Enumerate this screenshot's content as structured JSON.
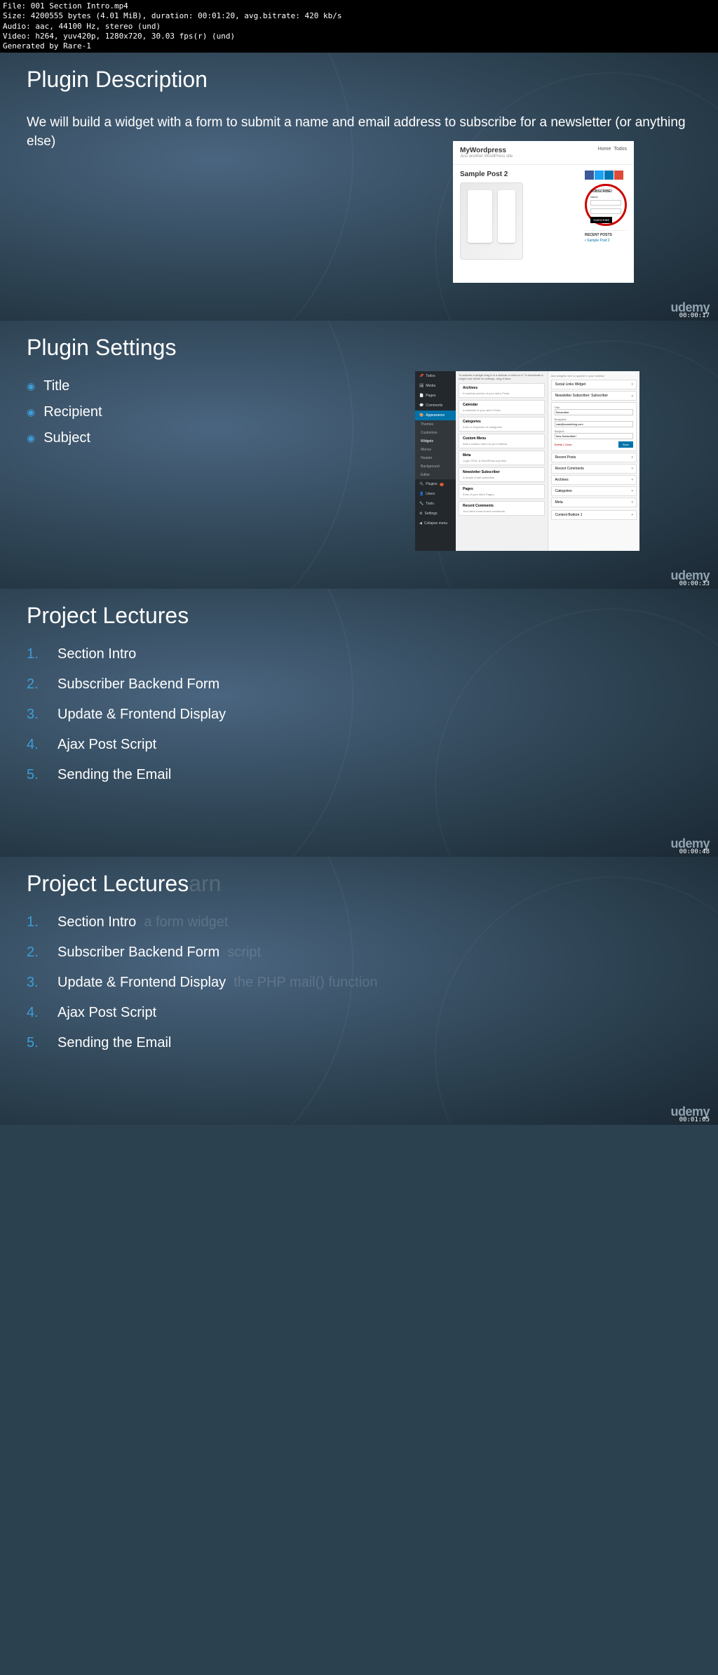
{
  "meta": {
    "file": "File: 001 Section Intro.mp4",
    "size": "Size: 4200555 bytes (4.01 MiB), duration: 00:01:20, avg.bitrate: 420 kb/s",
    "audio": "Audio: aac, 44100 Hz, stereo (und)",
    "video": "Video: h264, yuv420p, 1280x720, 30.03 fps(r) (und)",
    "gen": "Generated by Rare-1"
  },
  "slide1": {
    "title": "Plugin Description",
    "body": "We will build a widget with a form to submit a name and email address to subscribe for a newsletter (or anything else)",
    "thumb": {
      "sitename": "MyWordpress",
      "tagline": "Just another WordPress site",
      "nav1": "Home",
      "nav2": "Todos",
      "post_title": "Sample Post 2",
      "subscribe_label": "SUBSCRIBE!",
      "name_label": "Name",
      "subscribe_btn": "SUBSCRIBE",
      "recent_label": "RECENT POSTS",
      "recent_item": "Sample Post 2"
    },
    "timestamp": "00:00:17"
  },
  "slide2": {
    "title": "Plugin Settings",
    "bullets": [
      "Title",
      "Recipient",
      "Subject"
    ],
    "thumb": {
      "menu": [
        "Todos",
        "Media",
        "Pages",
        "Comments"
      ],
      "active_menu": "Appearance",
      "sub_menu": [
        "Themes",
        "Customize",
        "Widgets",
        "Menus",
        "Header",
        "Background",
        "Editor"
      ],
      "menu_bottom": [
        "Plugins",
        "Users",
        "Tools",
        "Settings",
        "Collapse menu"
      ],
      "hint": "To activate a widget drag it to a sidebar or click on it. To deactivate a widget and delete its settings, drag it back.",
      "widgets": [
        {
          "name": "Archives",
          "desc": "A monthly archive of your site's Posts."
        },
        {
          "name": "Calendar",
          "desc": "A calendar of your site's Posts."
        },
        {
          "name": "Categories",
          "desc": "A list or dropdown of categories."
        },
        {
          "name": "Custom Menu",
          "desc": "Add a custom menu to your sidebar."
        },
        {
          "name": "Meta",
          "desc": "Login, RSS, & WordPress.org links."
        },
        {
          "name": "Newsletter Subscriber",
          "desc": "A simple email subscriber"
        },
        {
          "name": "Pages",
          "desc": "A list of your site's Pages."
        },
        {
          "name": "Recent Comments",
          "desc": "Your site's most recent comments."
        }
      ],
      "zone_hint": "Add widgets here to appear in your sidebar.",
      "zone_widgets": [
        "Social Links Widget"
      ],
      "expanded_title": "Newsletter Subscriber: Subscriber",
      "form": {
        "title_label": "Title:",
        "title_value": "Subscriber",
        "recipient_label": "Recipient:",
        "recipient_value": "brad@something.com",
        "subject_label": "Subject:",
        "subject_value": "New Subscriber!",
        "delete": "Delete",
        "close": "Close",
        "save": "Save"
      },
      "collapsed": [
        "Recent Posts",
        "Recent Comments",
        "Archives",
        "Categories",
        "Meta"
      ],
      "bottom_zone": "Content Bottom 1"
    },
    "timestamp": "00:00:33"
  },
  "slide3": {
    "title": "Project Lectures",
    "items": [
      "Section Intro",
      "Subscriber Backend Form",
      "Update & Frontend Display",
      "Ajax Post Script",
      "Sending the Email"
    ],
    "timestamp": "00:00:48"
  },
  "slide4": {
    "title": "Project Lectures",
    "ghost_title_suffix": "arn",
    "items": [
      "Section Intro",
      "Subscriber Backend Form",
      "Update & Frontend Display",
      "Ajax Post Script",
      "Sending the Email"
    ],
    "ghosts": [
      "a form widget",
      "script",
      "the PHP mail() function"
    ],
    "timestamp": "00:01:05"
  },
  "brand": "udemy"
}
